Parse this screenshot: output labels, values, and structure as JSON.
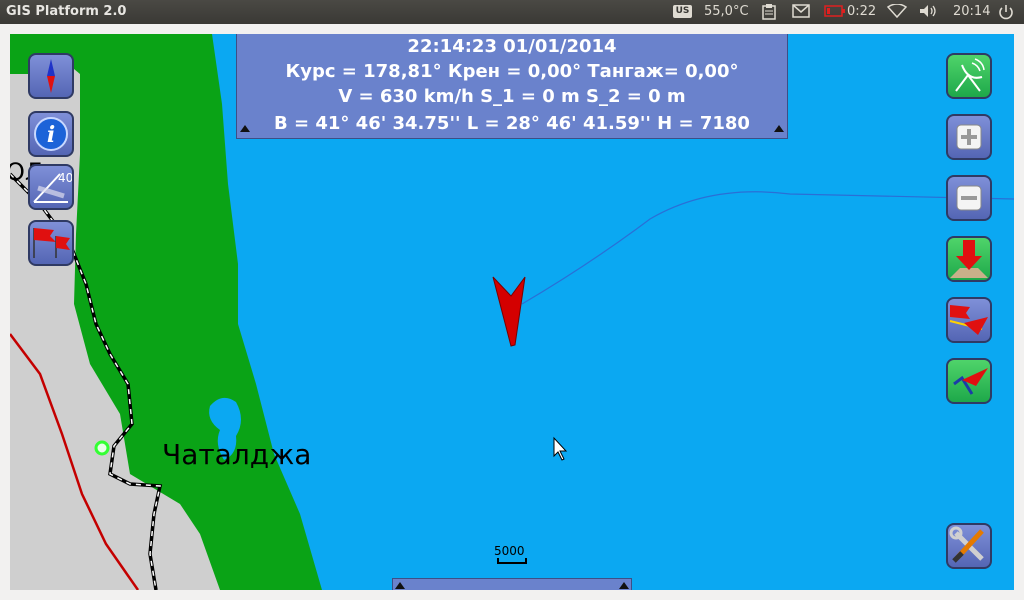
{
  "window": {
    "title": "GIS Platform 2.0"
  },
  "system_tray": {
    "keyboard_layout": "US",
    "temperature": "55,0°C",
    "battery_time": "0:22",
    "clock": "20:14"
  },
  "info_panel": {
    "datetime": "22:14:23 01/01/2014",
    "attitude": "Курс = 178,81° Крен = 0,00° Тангаж= 0,00°",
    "speed_distance": "V = 630 km/h S_1 = 0 m S_2 = 0 m",
    "coordinates": "B = 41° 46' 34.75''  L = 28° 46' 41.59'' H = 7180"
  },
  "map": {
    "place_label": "Чаталджа",
    "partial_label": "ОЛ",
    "scale_label": "5000",
    "angle_label": "40°"
  },
  "colors": {
    "sea": "#0ba8f2",
    "land": "#cfcfcf",
    "forest": "#0aa316",
    "panel": "#6a82cc",
    "aircraft": "#d40000"
  },
  "left_toolbar": [
    {
      "icon": "compass-icon"
    },
    {
      "icon": "info-icon"
    },
    {
      "icon": "angle-ruler-icon"
    },
    {
      "icon": "red-flags-icon"
    }
  ],
  "right_toolbar": [
    {
      "icon": "satellite-dish-icon"
    },
    {
      "icon": "zoom-in-icon"
    },
    {
      "icon": "zoom-out-icon"
    },
    {
      "icon": "download-map-icon"
    },
    {
      "icon": "route-flags-icon"
    },
    {
      "icon": "track-arrow-icon"
    },
    {
      "icon": "tools-settings-icon"
    }
  ]
}
